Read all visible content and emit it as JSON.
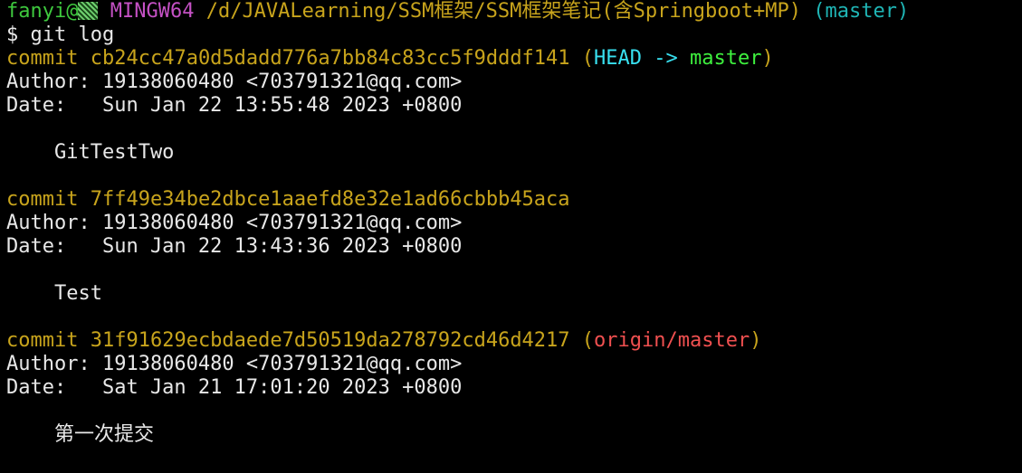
{
  "prompt": {
    "user_host": "fanyi@",
    "system": "MINGW64",
    "path": "/d/JAVALearning/SSM框架/SSM框架笔记(含Springboot+MP)",
    "branch": "(master)"
  },
  "command": "$ git log",
  "commits": [
    {
      "keyword": "commit",
      "hash": "cb24cc47a0d5dadd776a7bb84c83cc5f9dddf141",
      "ref_open": "(",
      "ref_head": "HEAD -> ",
      "ref_branch": "master",
      "ref_close": ")",
      "author": "Author: 19138060480 <703791321@qq.com>",
      "date": "Date:   Sun Jan 22 13:55:48 2023 +0800",
      "message": "    GitTestTwo"
    },
    {
      "keyword": "commit",
      "hash": "7ff49e34be2dbce1aaefd8e32e1ad66cbbb45aca",
      "author": "Author: 19138060480 <703791321@qq.com>",
      "date": "Date:   Sun Jan 22 13:43:36 2023 +0800",
      "message": "    Test"
    },
    {
      "keyword": "commit",
      "hash": "31f91629ecbdaede7d50519da278792cd46d4217",
      "ref_open": "(",
      "ref_remote": "origin/master",
      "ref_close": ")",
      "author": "Author: 19138060480 <703791321@qq.com>",
      "date": "Date:   Sat Jan 21 17:01:20 2023 +0800",
      "message": "    第一次提交"
    }
  ],
  "colors": {
    "background": "#000000",
    "prompt_user": "#3ec93e",
    "prompt_system": "#c451c4",
    "prompt_path": "#c8a41c",
    "prompt_branch": "#1fb5b5",
    "commit_hash": "#c8a41c",
    "ref_head": "#38e0f0",
    "ref_local_branch": "#3ef03e",
    "ref_remote_branch": "#f05050",
    "text": "#e8e8e8"
  }
}
